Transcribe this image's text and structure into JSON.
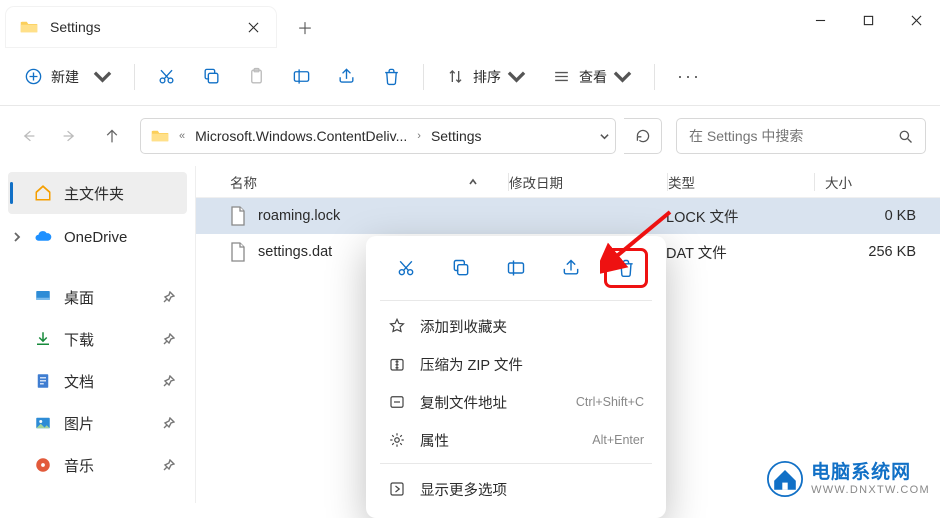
{
  "tab": {
    "title": "Settings"
  },
  "toolbar": {
    "new_label": "新建",
    "sort_label": "排序",
    "view_label": "查看"
  },
  "breadcrumb": {
    "part1": "Microsoft.Windows.ContentDeliv...",
    "part2": "Settings"
  },
  "search": {
    "placeholder": "在 Settings 中搜索"
  },
  "sidebar": {
    "home": "主文件夹",
    "onedrive": "OneDrive",
    "desktop": "桌面",
    "downloads": "下载",
    "documents": "文档",
    "pictures": "图片",
    "music": "音乐"
  },
  "columns": {
    "name": "名称",
    "date": "修改日期",
    "type": "类型",
    "size": "大小"
  },
  "files": [
    {
      "name": "roaming.lock",
      "type": "LOCK 文件",
      "size": "0 KB"
    },
    {
      "name": "settings.dat",
      "type": "DAT 文件",
      "size": "256 KB"
    }
  ],
  "ctx": {
    "fav": "添加到收藏夹",
    "zip": "压缩为 ZIP 文件",
    "copypath": "复制文件地址",
    "copypath_accel": "Ctrl+Shift+C",
    "props": "属性",
    "props_accel": "Alt+Enter",
    "more": "显示更多选项"
  },
  "watermark": {
    "title": "电脑系统网",
    "url": "WWW.DNXTW.COM"
  }
}
